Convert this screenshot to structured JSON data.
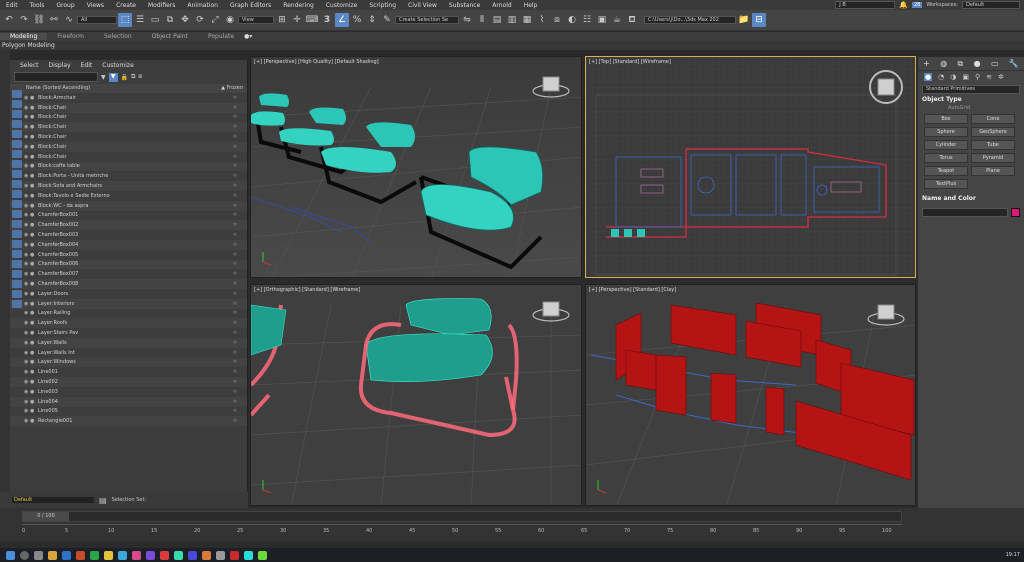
{
  "menubar": {
    "items": [
      "Edit",
      "Tools",
      "Group",
      "Views",
      "Create",
      "Modifiers",
      "Animation",
      "Graph Editors",
      "Rendering",
      "Customize",
      "Scripting",
      "Civil View",
      "Substance",
      "Arnold",
      "Help"
    ],
    "user": "J B",
    "workspaces_label": "Workspaces:",
    "workspace_value": "Default",
    "badge_count": "28"
  },
  "toolbar": {
    "selection_filter": "All",
    "view": "View",
    "selection_set": "Create Selection Se",
    "path": "C:\\Users\\j\\Do...\\3ds Max 202"
  },
  "ribbon": {
    "tabs": [
      "Modeling",
      "Freeform",
      "Selection",
      "Object Paint",
      "Populate"
    ],
    "sub_label": "Polygon Modeling"
  },
  "explorer": {
    "menu": [
      "Select",
      "Display",
      "Edit",
      "Customize"
    ],
    "col_name": "Name (Sorted Ascending)",
    "col_frozen": "▲ Frozen",
    "rows": [
      "Block:Armchair",
      "Block:Chair",
      "Block:Chair",
      "Block:Chair",
      "Block:Chair",
      "Block:Chair",
      "Block:Chair",
      "Block:coffe table",
      "Block:Porta - Unità metriche",
      "Block:Sofa and Armchairs",
      "Block:Tavolo e Sedie Esterno",
      "Block:WC - da aspra",
      "ChamferBox001",
      "ChamferBox002",
      "ChamferBox003",
      "ChamferBox004",
      "ChamferBox005",
      "ChamferBox006",
      "ChamferBox007",
      "ChamferBox008",
      "Layer:Doors",
      "Layer:Interiors",
      "Layer:Railing",
      "Layer:Roofs",
      "Layer:Stairs Pav",
      "Layer:Walls",
      "Layer:Walls Int",
      "Layer:Windows",
      "Line001",
      "Line002",
      "Line003",
      "Line004",
      "Line005",
      "Rectangle001"
    ]
  },
  "status": {
    "layer": "Default",
    "selection_set": "Selection Set:",
    "frame": "0 / 100"
  },
  "viewports": {
    "tl": "[+] [Perspective] [High Quality] [Default Shading]",
    "tr": "[+] [Top] [Standard] [Wireframe]",
    "bl": "[+] [Orthographic] [Standard] [Wireframe]",
    "br": "[+] [Perspective] [Standard] [Clay]"
  },
  "command_panel": {
    "dropdown": "Standard Primitives",
    "object_type": "Object Type",
    "autogrid": "AutoGrid",
    "buttons": [
      "Box",
      "Cone",
      "Sphere",
      "GeoSphere",
      "Cylinder",
      "Tube",
      "Torus",
      "Pyramid",
      "Teapot",
      "Plane",
      "TextPlus"
    ],
    "name_color": "Name and Color"
  },
  "timeline": {
    "ticks": [
      "0",
      "5",
      "10",
      "15",
      "20",
      "25",
      "30",
      "35",
      "40",
      "45",
      "50",
      "55",
      "60",
      "65",
      "70",
      "75",
      "80",
      "85",
      "90",
      "95",
      "100"
    ]
  },
  "taskbar": {
    "time": "19:17"
  },
  "colors": {
    "accent": "#5a88c5",
    "teal": "#2bc6b6",
    "wire_red": "#ff5a6e",
    "clay_red": "#b41414",
    "name_swatch": "#e0187a"
  }
}
